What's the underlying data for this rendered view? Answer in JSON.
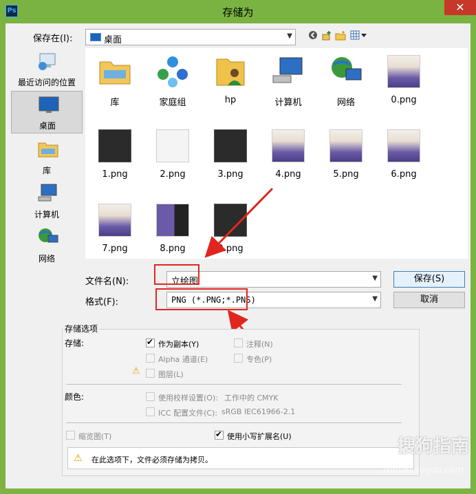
{
  "window": {
    "title": "存储为",
    "app_icon": "Ps",
    "close": "✕"
  },
  "header": {
    "save_in_label": "保存在(I):",
    "save_in_value": "桌面"
  },
  "places": [
    {
      "label": "最近访问的位置",
      "icon": "recent-places-icon"
    },
    {
      "label": "桌面",
      "icon": "desktop-icon",
      "selected": true
    },
    {
      "label": "库",
      "icon": "library-icon"
    },
    {
      "label": "计算机",
      "icon": "computer-icon"
    },
    {
      "label": "网络",
      "icon": "network-icon"
    }
  ],
  "files": [
    {
      "name": "库",
      "kind": "library"
    },
    {
      "name": "家庭组",
      "kind": "homegroup"
    },
    {
      "name": "hp",
      "kind": "user"
    },
    {
      "name": "计算机",
      "kind": "computer"
    },
    {
      "name": "网络",
      "kind": "network"
    },
    {
      "name": "0.png",
      "kind": "girl"
    },
    {
      "name": "1.png",
      "kind": "dark"
    },
    {
      "name": "2.png",
      "kind": "light"
    },
    {
      "name": "3.png",
      "kind": "dark"
    },
    {
      "name": "4.png",
      "kind": "girl"
    },
    {
      "name": "5.png",
      "kind": "girl"
    },
    {
      "name": "6.png",
      "kind": "girl"
    },
    {
      "name": "7.png",
      "kind": "girl"
    },
    {
      "name": "8.png",
      "kind": "mixed"
    },
    {
      "name": "9.png",
      "kind": "dark"
    }
  ],
  "form": {
    "filename_label": "文件名(N):",
    "filename_value": "立绘图",
    "format_label": "格式(F):",
    "format_value": "PNG (*.PNG;*.PNS)",
    "save_button": "保存(S)",
    "cancel_button": "取消"
  },
  "options": {
    "title": "存储选项",
    "store_label": "存储:",
    "as_copy": "作为副本(Y)",
    "annotations": "注释(N)",
    "alpha": "Alpha 通道(E)",
    "spot_color": "专色(P)",
    "layers": "图层(L)",
    "color_label": "颜色:",
    "proof_setup": "使用校样设置(O):",
    "proof_value": "工作中的 CMYK",
    "icc_profile": "ICC 配置文件(C):",
    "icc_value": "sRGB IEC61966-2.1",
    "thumbnail": "缩览图(T)",
    "lowercase_ext": "使用小写扩展名(U)",
    "warning": "在此选项下，文件必须存储为拷贝。"
  },
  "watermark": {
    "brand": "搜狗指南",
    "url": "zhinan.sogou.com"
  }
}
